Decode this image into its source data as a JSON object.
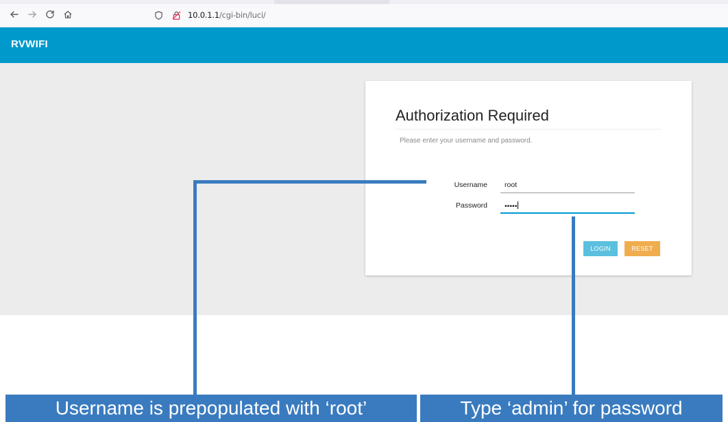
{
  "browser": {
    "url_host": "10.0.1.1",
    "url_path": "/cgi-bin/luci/"
  },
  "app": {
    "title": "RVWIFI"
  },
  "login": {
    "heading": "Authorization Required",
    "description": "Please enter your username and password.",
    "username_label": "Username",
    "username_value": "root",
    "password_label": "Password",
    "password_value": "•••••",
    "login_button": "LOGIN",
    "reset_button": "RESET"
  },
  "annotations": {
    "left_caption": "Username is prepopulated with ‘root’",
    "right_caption": "Type ‘admin’ for password"
  },
  "colors": {
    "header": "#0099cc",
    "login_button": "#5bc0de",
    "reset_button": "#f0ad4e",
    "callout": "#3a7bbf"
  }
}
